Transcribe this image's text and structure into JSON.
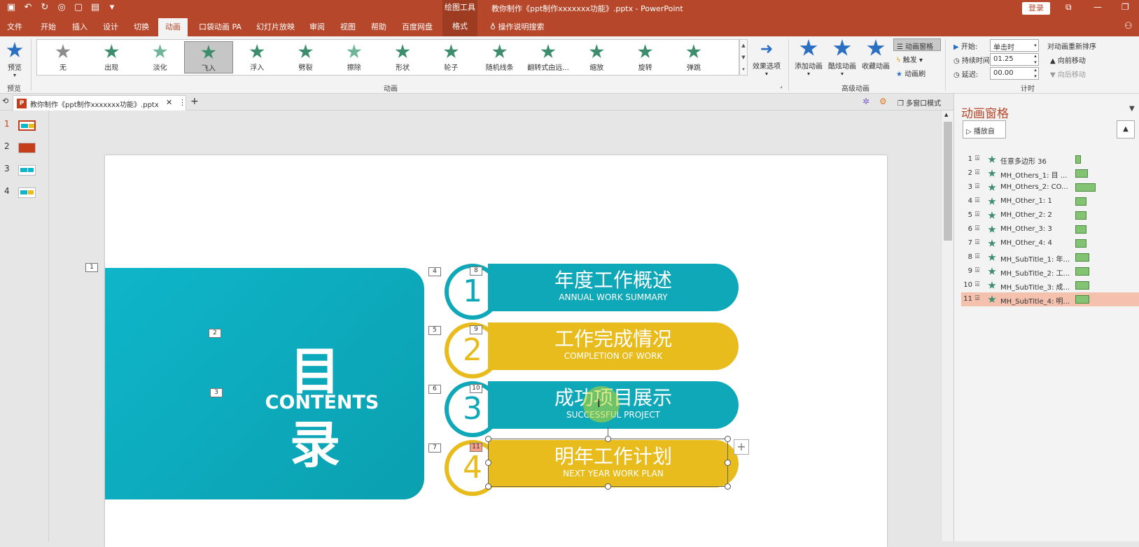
{
  "title_bar": {
    "drawing_tools": "绘图工具",
    "document_title": "教你制作《ppt制作xxxxxxx功能》.pptx  -  PowerPoint",
    "login": "登录"
  },
  "menu": {
    "items": [
      "文件",
      "开始",
      "插入",
      "设计",
      "切换",
      "动画",
      "口袋动画 PA",
      "幻灯片放映",
      "审阅",
      "视图",
      "帮助",
      "百度网盘"
    ],
    "active": "动画",
    "format_tab": "格式",
    "tell_me": "操作说明搜索"
  },
  "ribbon": {
    "preview": {
      "label": "预览",
      "group": "预览"
    },
    "animations": [
      {
        "label": "无",
        "color": "#8c8c8c"
      },
      {
        "label": "出现",
        "color": "#3c8c6e"
      },
      {
        "label": "淡化",
        "color": "#6fb59a"
      },
      {
        "label": "飞入",
        "color": "#3c8c6e"
      },
      {
        "label": "浮入",
        "color": "#3c8c6e"
      },
      {
        "label": "劈裂",
        "color": "#3c8c6e"
      },
      {
        "label": "擦除",
        "color": "#6fb59a"
      },
      {
        "label": "形状",
        "color": "#3c8c6e"
      },
      {
        "label": "轮子",
        "color": "#3c8c6e"
      },
      {
        "label": "随机线条",
        "color": "#3c8c6e"
      },
      {
        "label": "翻转式由远...",
        "color": "#3c8c6e"
      },
      {
        "label": "缩放",
        "color": "#3c8c6e"
      },
      {
        "label": "旋转",
        "color": "#3c8c6e"
      },
      {
        "label": "弹跳",
        "color": "#3c8c6e"
      }
    ],
    "animation_group": "动画",
    "effect_options": "效果选项",
    "advanced": {
      "add": "添加动画",
      "cool": "酷炫动画",
      "favorite": "收藏动画",
      "pane": "动画窗格",
      "trigger": "触发",
      "painter": "动画刷",
      "group": "高级动画"
    },
    "timing": {
      "start_label": "开始:",
      "start_value": "单击时",
      "duration_label": "持续时间:",
      "duration_value": "01.25",
      "delay_label": "延迟:",
      "delay_value": "00.00",
      "reorder": "对动画重新排序",
      "move_earlier": "向前移动",
      "move_later": "向后移动",
      "group": "计时"
    }
  },
  "tabs": {
    "doc_tab": "教你制作《ppt制作xxxxxxx功能》.pptx",
    "multi_window": "多窗口模式"
  },
  "thumbnails": [
    "1",
    "2",
    "3",
    "4"
  ],
  "slide": {
    "title": "目 录",
    "subtitle": "CONTENTS",
    "items": [
      {
        "num": "1",
        "cn": "年度工作概述",
        "en": "ANNUAL WORK SUMMARY",
        "color": "#0fa8b8",
        "tag_left": "4",
        "tag_top": "8"
      },
      {
        "num": "2",
        "cn": "工作完成情况",
        "en": "COMPLETION OF WORK",
        "color": "#e8bc1c",
        "tag_left": "5",
        "tag_top": "9"
      },
      {
        "num": "3",
        "cn": "成功项目展示",
        "en": "SUCCESSFUL PROJECT",
        "color": "#0fa8b8",
        "tag_left": "6",
        "tag_top": "10"
      },
      {
        "num": "4",
        "cn": "明年工作计划",
        "en": "NEXT YEAR WORK PLAN",
        "color": "#e8bc1c",
        "tag_left": "7",
        "tag_top": "11"
      }
    ],
    "tags_left": [
      "1",
      "2",
      "3"
    ]
  },
  "anim_pane": {
    "title": "动画窗格",
    "play_from": "播放自",
    "items": [
      {
        "num": "1",
        "name": "任意多边形 36",
        "start": 0.0,
        "duration": 0.25
      },
      {
        "num": "2",
        "name": "MH_Others_1: 目 ...",
        "start": 0.0,
        "duration": 1.0
      },
      {
        "num": "3",
        "name": "MH_Others_2: CO...",
        "start": 0.0,
        "duration": 1.6
      },
      {
        "num": "4",
        "name": "MH_Other_1: 1",
        "start": 0.0,
        "duration": 0.9
      },
      {
        "num": "5",
        "name": "MH_Other_2: 2",
        "start": 0.0,
        "duration": 0.9
      },
      {
        "num": "6",
        "name": "MH_Other_3: 3",
        "start": 0.0,
        "duration": 0.9
      },
      {
        "num": "7",
        "name": "MH_Other_4: 4",
        "start": 0.0,
        "duration": 0.9
      },
      {
        "num": "8",
        "name": "MH_SubTitle_1: 年...",
        "start": 0.0,
        "duration": 1.1
      },
      {
        "num": "9",
        "name": "MH_SubTitle_2: 工...",
        "start": 0.0,
        "duration": 1.1
      },
      {
        "num": "10",
        "name": "MH_SubTitle_3: 成...",
        "start": 0.0,
        "duration": 1.1
      },
      {
        "num": "11",
        "name": "MH_SubTitle_4: 明...",
        "start": 0.0,
        "duration": 1.1
      }
    ],
    "selected": "11"
  }
}
